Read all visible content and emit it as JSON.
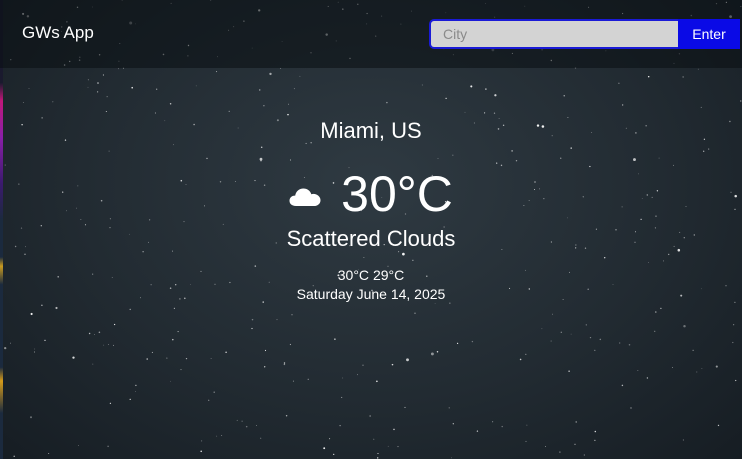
{
  "app": {
    "brand": "GWs App"
  },
  "search": {
    "placeholder": "City",
    "value": "",
    "button_label": "Enter"
  },
  "weather": {
    "location": "Miami, US",
    "icon": "cloud-icon",
    "temperature": "30°C",
    "condition": "Scattered Clouds",
    "high": "30°C",
    "low": "29°C",
    "date": "Saturday June 14, 2025"
  },
  "colors": {
    "accent": "#0a0ae6",
    "input_bg": "#d3d3d3",
    "background": "#222b32",
    "text": "#ffffff"
  }
}
